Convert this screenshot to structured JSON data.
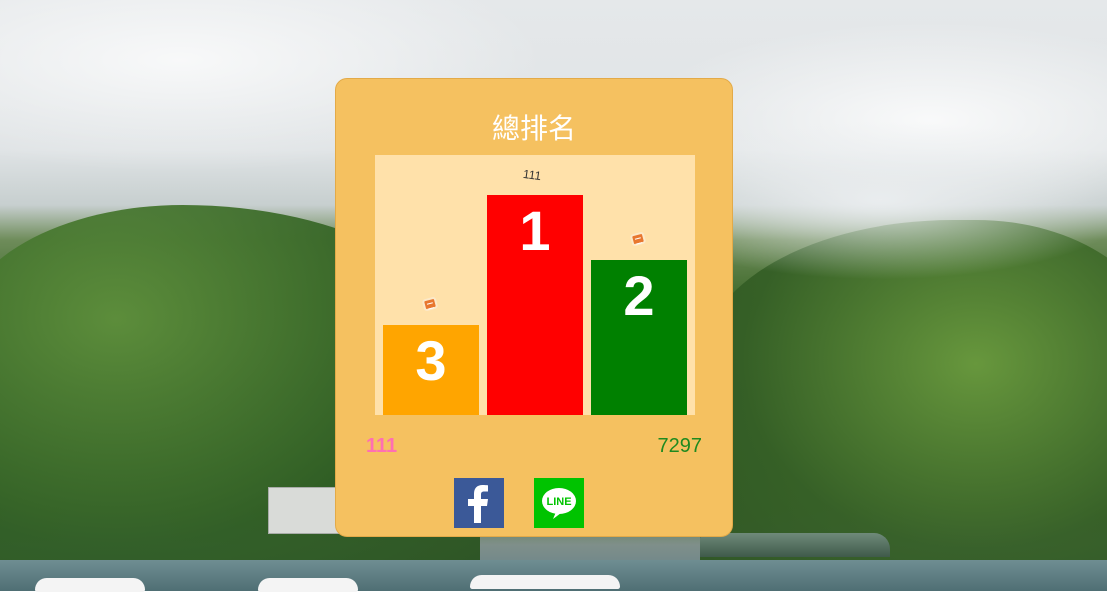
{
  "card": {
    "title": "總排名",
    "left_value": "111",
    "right_value": "7297"
  },
  "chart_data": {
    "type": "bar",
    "categories": [
      "3",
      "1",
      "2"
    ],
    "values": [
      90,
      220,
      155
    ],
    "bar_colors": [
      "#ffa500",
      "#ff0000",
      "#008000"
    ],
    "top_name": "111"
  },
  "social": {
    "facebook": {
      "icon": "facebook-icon",
      "color": "#3b5998"
    },
    "line": {
      "icon": "line-icon",
      "color": "#00c300",
      "text": "LINE"
    }
  },
  "colors": {
    "card_bg": "#f5c160",
    "chart_bg": "#ffe1aa",
    "title": "#ffffff",
    "left_value": "#ff6fb2",
    "right_value": "#1f8a1f"
  }
}
